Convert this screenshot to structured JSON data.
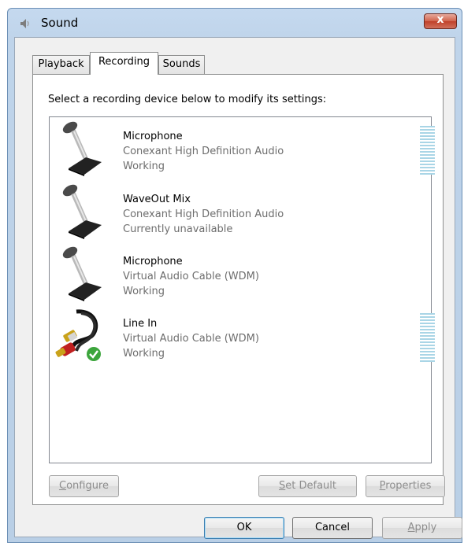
{
  "window": {
    "title": "Sound",
    "close_label": "x"
  },
  "tabs": [
    {
      "label": "Playback",
      "active": false
    },
    {
      "label": "Recording",
      "active": true
    },
    {
      "label": "Sounds",
      "active": false
    }
  ],
  "instruction": "Select a recording device below to modify its settings:",
  "devices": [
    {
      "name": "Microphone",
      "driver": "Conexant High Definition Audio",
      "status": "Working",
      "icon": "microphone-icon",
      "level_meter": true,
      "is_default": false
    },
    {
      "name": "WaveOut Mix",
      "driver": "Conexant High Definition Audio",
      "status": "Currently unavailable",
      "icon": "microphone-icon",
      "level_meter": false,
      "is_default": false
    },
    {
      "name": "Microphone",
      "driver": "Virtual Audio Cable (WDM)",
      "status": "Working",
      "icon": "microphone-icon",
      "level_meter": false,
      "is_default": false
    },
    {
      "name": "Line In",
      "driver": "Virtual Audio Cable (WDM)",
      "status": "Working",
      "icon": "rca-cable-icon",
      "level_meter": true,
      "is_default": true
    }
  ],
  "buttons": {
    "configure": {
      "mnemonic": "C",
      "rest": "onfigure"
    },
    "set_default": {
      "mnemonic": "S",
      "rest": "et Default"
    },
    "properties": {
      "mnemonic": "P",
      "rest": "roperties"
    },
    "ok": "OK",
    "cancel": "Cancel",
    "apply": {
      "mnemonic": "A",
      "rest": "pply"
    }
  },
  "colors": {
    "meter": "#a9d5e6",
    "default_check": "#3ca53c",
    "close_button": "#c9523d"
  }
}
